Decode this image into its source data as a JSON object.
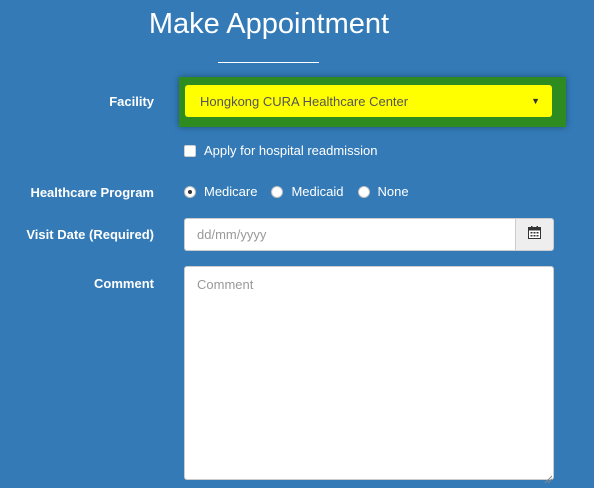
{
  "page": {
    "title": "Make Appointment"
  },
  "form": {
    "facility": {
      "label": "Facility",
      "selected": "Hongkong CURA Healthcare Center",
      "highlight_color": "#ffff00",
      "frame_color": "#2e8b1f"
    },
    "readmission": {
      "label": "Apply for hospital readmission",
      "checked": false
    },
    "program": {
      "label": "Healthcare Program",
      "options": [
        {
          "label": "Medicare",
          "checked": true
        },
        {
          "label": "Medicaid",
          "checked": false
        },
        {
          "label": "None",
          "checked": false
        }
      ]
    },
    "visit_date": {
      "label": "Visit Date (Required)",
      "placeholder": "dd/mm/yyyy",
      "icon": "calendar-icon"
    },
    "comment": {
      "label": "Comment",
      "placeholder": "Comment"
    }
  },
  "colors": {
    "background": "#337ab7",
    "text": "#ffffff"
  }
}
